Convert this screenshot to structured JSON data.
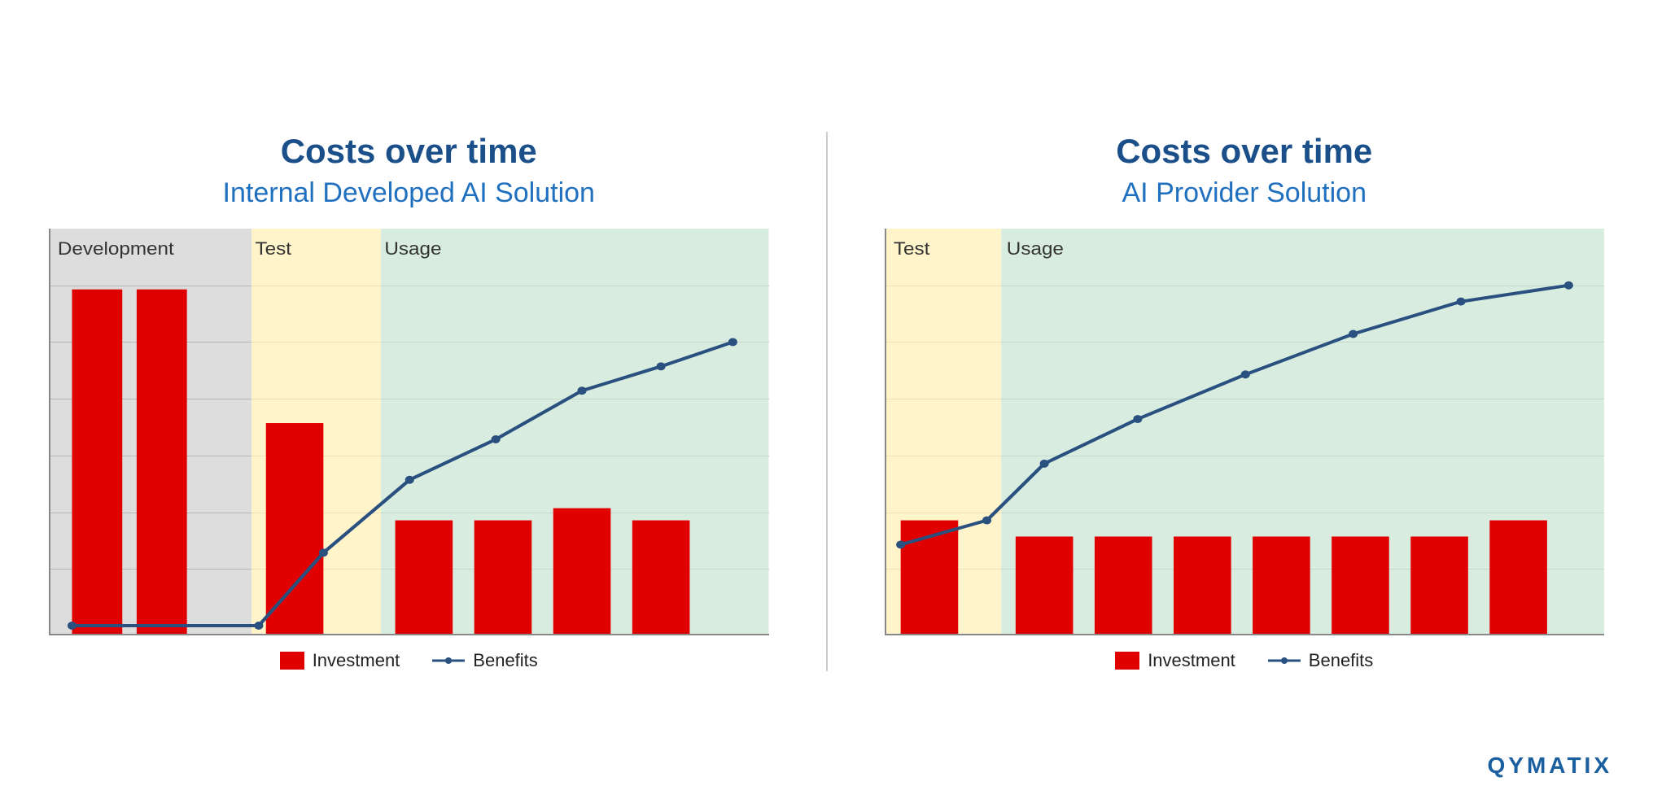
{
  "left_chart": {
    "title": "Costs over time",
    "subtitle": "Internal Developed AI Solution",
    "phases": [
      {
        "label": "Development",
        "color": "rgba(180,180,180,0.45)",
        "start_pct": 0,
        "width_pct": 28
      },
      {
        "label": "Test",
        "color": "rgba(255,240,180,0.7)",
        "start_pct": 28,
        "width_pct": 18
      },
      {
        "label": "Usage",
        "color": "rgba(200,230,210,0.7)",
        "start_pct": 46,
        "width_pct": 54
      }
    ],
    "bars": [
      {
        "x_pct": 3,
        "width_pct": 7,
        "height_pct": 85
      },
      {
        "x_pct": 12,
        "width_pct": 7,
        "height_pct": 85
      },
      {
        "x_pct": 30,
        "width_pct": 8,
        "height_pct": 52
      },
      {
        "x_pct": 48,
        "width_pct": 8,
        "height_pct": 28
      },
      {
        "x_pct": 59,
        "width_pct": 8,
        "height_pct": 28
      },
      {
        "x_pct": 70,
        "width_pct": 8,
        "height_pct": 31
      },
      {
        "x_pct": 81,
        "width_pct": 8,
        "height_pct": 28
      }
    ],
    "benefits_line": [
      {
        "x_pct": 3,
        "y_pct": 98
      },
      {
        "x_pct": 29,
        "y_pct": 98
      },
      {
        "x_pct": 38,
        "y_pct": 80
      },
      {
        "x_pct": 50,
        "y_pct": 62
      },
      {
        "x_pct": 62,
        "y_pct": 52
      },
      {
        "x_pct": 74,
        "y_pct": 40
      },
      {
        "x_pct": 85,
        "y_pct": 34
      },
      {
        "x_pct": 95,
        "y_pct": 28
      }
    ],
    "legend": {
      "investment_label": "Investment",
      "benefits_label": "Benefits"
    }
  },
  "right_chart": {
    "title": "Costs over time",
    "subtitle": "AI Provider Solution",
    "phases": [
      {
        "label": "Test",
        "color": "rgba(255,240,180,0.7)",
        "start_pct": 0,
        "width_pct": 16
      },
      {
        "label": "Usage",
        "color": "rgba(200,230,210,0.7)",
        "start_pct": 16,
        "width_pct": 84
      }
    ],
    "bars": [
      {
        "x_pct": 2,
        "width_pct": 8,
        "height_pct": 28
      },
      {
        "x_pct": 18,
        "width_pct": 8,
        "height_pct": 24
      },
      {
        "x_pct": 29,
        "width_pct": 8,
        "height_pct": 24
      },
      {
        "x_pct": 40,
        "width_pct": 8,
        "height_pct": 24
      },
      {
        "x_pct": 51,
        "width_pct": 8,
        "height_pct": 24
      },
      {
        "x_pct": 62,
        "width_pct": 8,
        "height_pct": 24
      },
      {
        "x_pct": 73,
        "width_pct": 8,
        "height_pct": 24
      },
      {
        "x_pct": 84,
        "width_pct": 8,
        "height_pct": 28
      }
    ],
    "benefits_line": [
      {
        "x_pct": 2,
        "y_pct": 78
      },
      {
        "x_pct": 14,
        "y_pct": 72
      },
      {
        "x_pct": 22,
        "y_pct": 58
      },
      {
        "x_pct": 35,
        "y_pct": 47
      },
      {
        "x_pct": 50,
        "y_pct": 36
      },
      {
        "x_pct": 65,
        "y_pct": 26
      },
      {
        "x_pct": 80,
        "y_pct": 18
      },
      {
        "x_pct": 95,
        "y_pct": 14
      }
    ],
    "legend": {
      "investment_label": "Investment",
      "benefits_label": "Benefits"
    }
  },
  "branding": "QYMATIX"
}
